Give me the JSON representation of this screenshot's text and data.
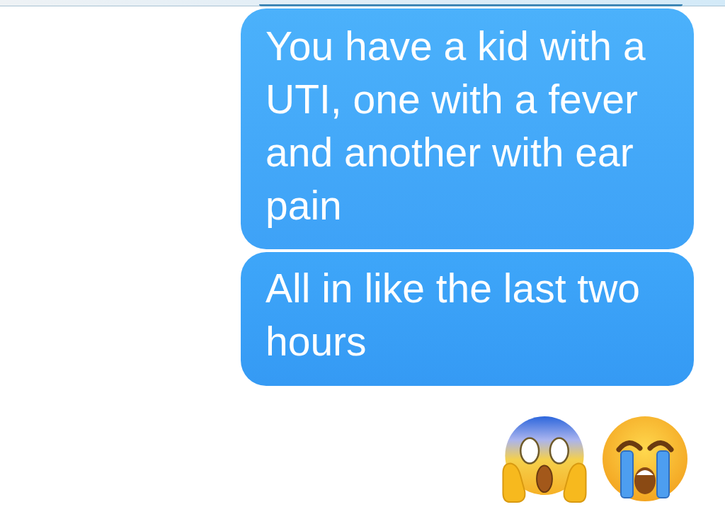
{
  "messages": [
    {
      "kind": "text",
      "text": "You have a kid with a UTI, one with a fever and another with ear pain"
    },
    {
      "kind": "text",
      "text": "All in like the last two hours"
    },
    {
      "kind": "emoji",
      "faces": [
        {
          "kind": "scream"
        },
        {
          "kind": "crying"
        }
      ]
    }
  ]
}
